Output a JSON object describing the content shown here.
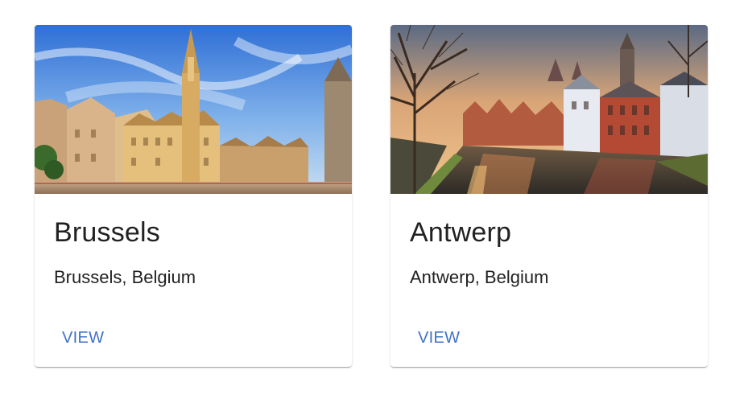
{
  "cards": [
    {
      "title": "Brussels",
      "subtitle": "Brussels, Belgium",
      "action_label": "VIEW",
      "image_icon": "photo-grand-place-brussels"
    },
    {
      "title": "Antwerp",
      "subtitle": "Antwerp, Belgium",
      "action_label": "VIEW",
      "image_icon": "photo-canal-city"
    }
  ],
  "colors": {
    "action_text": "#3f72c7",
    "title_text": "#212121",
    "card_background": "#ffffff"
  }
}
